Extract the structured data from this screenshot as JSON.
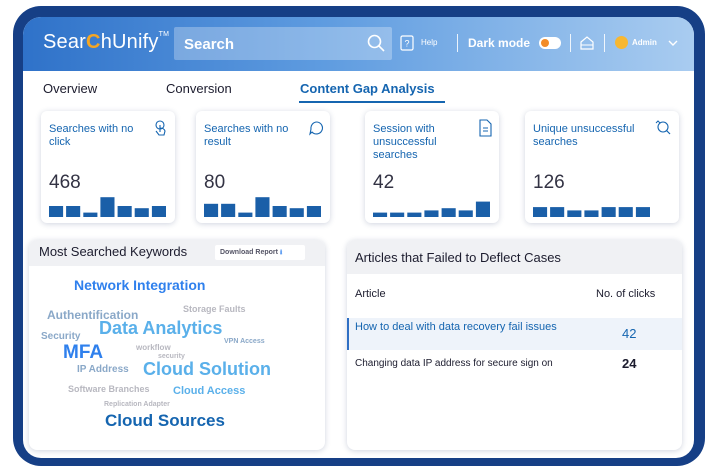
{
  "header": {
    "logo_pre": "Sear",
    "logo_c": "C",
    "logo_post": "hUnify",
    "logo_tm": "TM",
    "search_placeholder": "Search",
    "help_label": "Help",
    "dark_mode_label": "Dark mode",
    "dark_mode_on": true,
    "user_label": "Admin"
  },
  "tabs": [
    {
      "label": "Overview"
    },
    {
      "label": "Conversion"
    },
    {
      "label": "Content Gap Analysis",
      "active": true
    }
  ],
  "cards": [
    {
      "title": "Searches with no click",
      "value": "468",
      "icon": "touch-icon",
      "bars": [
        0.5,
        0.5,
        0.2,
        0.9,
        0.5,
        0.4,
        0.5
      ]
    },
    {
      "title": "Searches with no result",
      "value": "80",
      "icon": "chat-icon",
      "bars": [
        0.6,
        0.6,
        0.2,
        0.9,
        0.5,
        0.4,
        0.5
      ]
    },
    {
      "title": "Session with unsuccessful searches",
      "value": "42",
      "icon": "document-icon",
      "bars": [
        0.2,
        0.2,
        0.2,
        0.3,
        0.4,
        0.3,
        0.7
      ]
    },
    {
      "title": "Unique unsuccessful searches",
      "value": "126",
      "icon": "search-refresh-icon",
      "bars": [
        0.45,
        0.45,
        0.3,
        0.3,
        0.45,
        0.45,
        0.45
      ]
    }
  ],
  "keywords_panel": {
    "title": "Most Searched Keywords",
    "download_label": "Download Report",
    "keywords": [
      {
        "text": "Network Integration",
        "color": "#2f80ed"
      },
      {
        "text": "Authentification",
        "color": "#8aa8c8"
      },
      {
        "text": "Storage Faults",
        "color": "#b8b8c0"
      },
      {
        "text": "Security",
        "color": "#8aa8c8"
      },
      {
        "text": "Data Analytics",
        "color": "#5ab0ea"
      },
      {
        "text": "workflow",
        "color": "#b8b8c0"
      },
      {
        "text": "VPN Access",
        "color": "#8aa8c8"
      },
      {
        "text": "MFA",
        "color": "#2f80ed"
      },
      {
        "text": "security",
        "color": "#b8b8c0"
      },
      {
        "text": "IP Address",
        "color": "#8aa8c8"
      },
      {
        "text": "Cloud Solution",
        "color": "#5ab0ea"
      },
      {
        "text": "Software Branches",
        "color": "#b8b8c0"
      },
      {
        "text": "Cloud Access",
        "color": "#5ab0ea"
      },
      {
        "text": "Replication Adapter",
        "color": "#b8b8c0"
      },
      {
        "text": "Cloud Sources",
        "color": "#1565b0"
      }
    ]
  },
  "articles_panel": {
    "title": "Articles that Failed to Deflect Cases",
    "col_article": "Article",
    "col_clicks": "No. of clicks",
    "rows": [
      {
        "article": "How to deal with data recovery fail issues",
        "clicks": "42"
      },
      {
        "article": "Changing data IP address for secure sign on",
        "clicks": "24"
      }
    ]
  },
  "colors": {
    "frame": "#163f86",
    "accent": "#1565b0",
    "bar": "#1a5fa8",
    "toggle_knob": "#f28c28"
  }
}
